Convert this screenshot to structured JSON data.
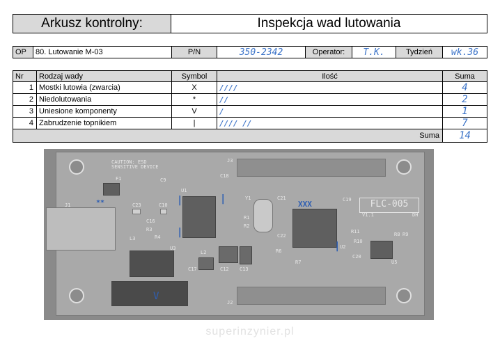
{
  "header": {
    "title_label": "Arkusz kontrolny:",
    "title_value": "Inspekcja wad lutowania"
  },
  "info": {
    "op_label": "OP",
    "op_value": "80. Lutowanie M-03",
    "pn_label": "P/N",
    "pn_value": "350-2342",
    "operator_label": "Operator:",
    "operator_value": "T.K.",
    "week_label": "Tydzień",
    "week_value": "wk.36"
  },
  "table": {
    "columns": [
      "Nr",
      "Rodzaj wady",
      "Symbol",
      "Ilość",
      "Suma"
    ],
    "rows": [
      {
        "nr": "1",
        "type": "Mostki lutowia (zwarcia)",
        "symbol": "X",
        "tally": "////",
        "sum": "4"
      },
      {
        "nr": "2",
        "type": "Niedolutowania",
        "symbol": "*",
        "tally": "//",
        "sum": "2"
      },
      {
        "nr": "3",
        "type": "Uniesione komponenty",
        "symbol": "V",
        "tally": "/",
        "sum": "1"
      },
      {
        "nr": "4",
        "type": "Zabrudzenie topnikiem",
        "symbol": "|",
        "tally": "//// //",
        "sum": "7"
      }
    ],
    "total_label": "Suma",
    "total_value": "14"
  },
  "board": {
    "caution": "CAUTION: ESD SENSITIVE DEVICE",
    "label": "FLC-005",
    "version": "V1.1",
    "revision": "DH",
    "refs": [
      "J1",
      "F1",
      "C23",
      "C10",
      "C9",
      "U1",
      "C16",
      "R3",
      "R4",
      "L3",
      "C18",
      "U3",
      "L2",
      "C17",
      "C12",
      "C13",
      "R6",
      "R7",
      "Y1",
      "R1",
      "R2",
      "C21",
      "C22",
      "C19",
      "U2",
      "J3",
      "J2",
      "R11",
      "R10",
      "R8",
      "R9",
      "C20",
      "U5"
    ],
    "marks": {
      "bridge": "XXX",
      "nosolder": "**",
      "lifted": "V",
      "flux": "|"
    }
  },
  "watermark": "superinzynier.pl"
}
